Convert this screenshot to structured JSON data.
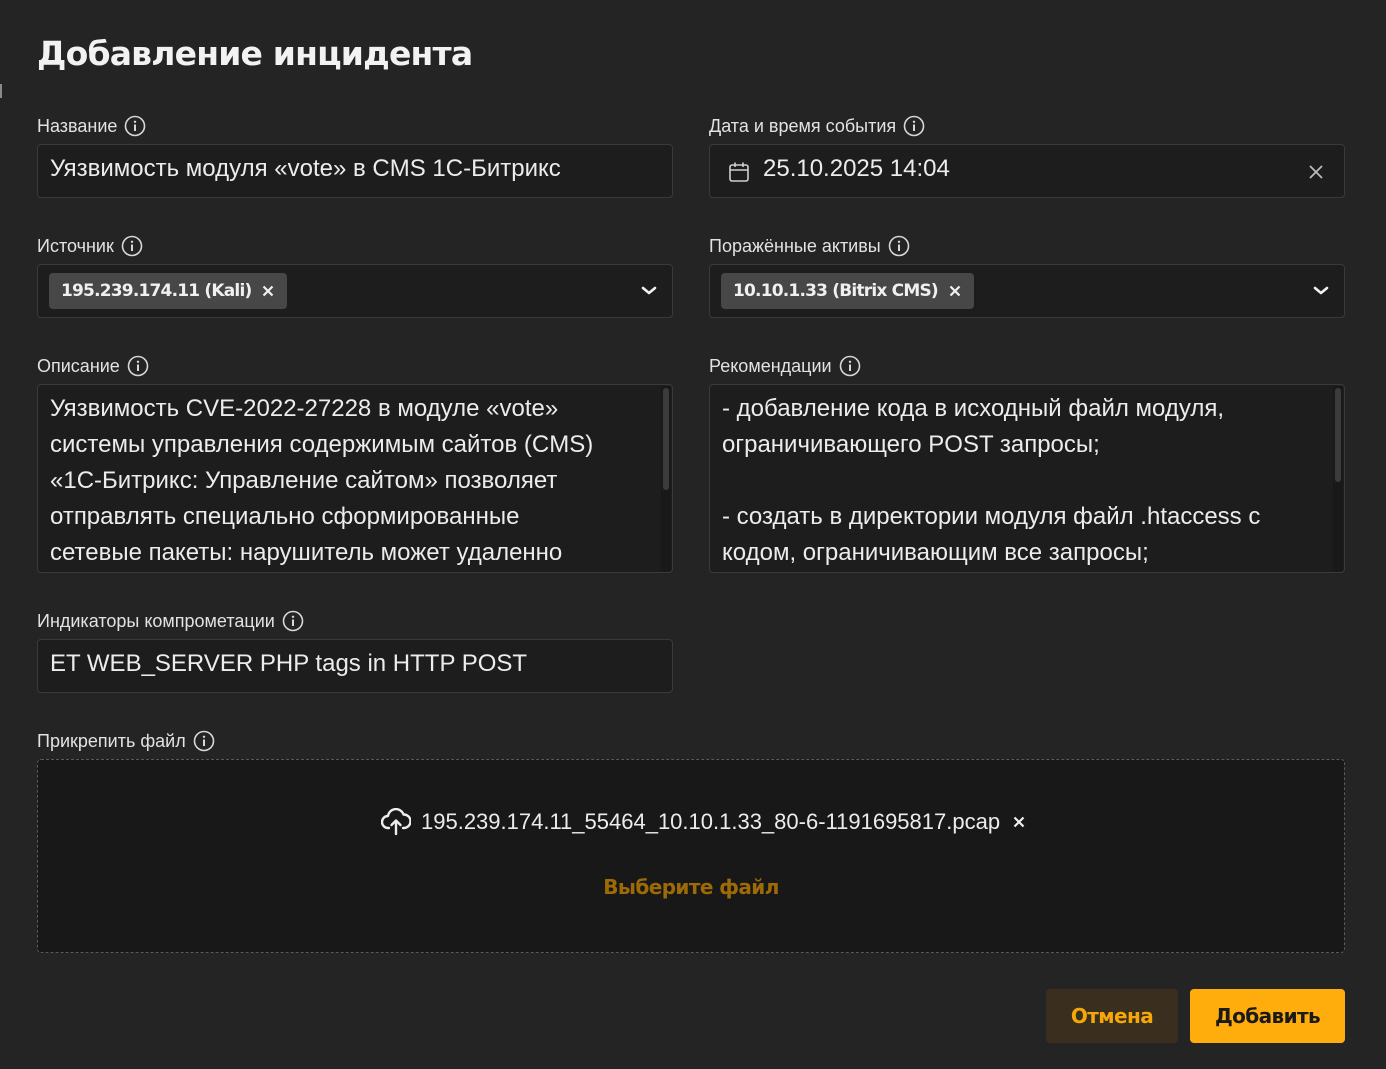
{
  "dialog": {
    "title": "Добавление инцидента"
  },
  "fields": {
    "name": {
      "label": "Название",
      "value": "Уязвимость модуля «vote» в CMS 1С-Битрикс"
    },
    "datetime": {
      "label": "Дата и время события",
      "value": "25.10.2025 14:04"
    },
    "source": {
      "label": "Источник",
      "tags": [
        "195.239.174.11 (Kali)"
      ]
    },
    "assets": {
      "label": "Поражённые активы",
      "tags": [
        "10.10.1.33 (Bitrix CMS)"
      ]
    },
    "description": {
      "label": "Описание",
      "value": "Уязвимость CVE-2022-27228 в модуле «vote»\nсистемы управления содержимым сайтов (CMS)\n«1С-Битрикс: Управление сайтом» позволяет\nотправлять специально сформированные\nсетевые пакеты: нарушитель может удаленно"
    },
    "recommendations": {
      "label": "Рекомендации",
      "value": "- добавление кода в исходный файл модуля,\nограничивающего POST запросы;\n\n- создать в директории модуля файл .htaccess с\nкодом, ограничивающим все запросы;"
    },
    "ioc": {
      "label": "Индикаторы компрометации",
      "value": "ET WEB_SERVER PHP tags in HTTP POST"
    },
    "attachment": {
      "label": "Прикрепить файл",
      "file_name": "195.239.174.11_55464_10.10.1.33_80-6-1191695817.pcap",
      "choose_label": "Выберите файл"
    }
  },
  "actions": {
    "cancel_label": "Отмена",
    "add_label": "Добавить"
  },
  "colors": {
    "background": "#242424",
    "accent": "#ffad0d",
    "accent_text": "#f5a70a",
    "muted_accent": "#9e6a05"
  },
  "icons": {
    "info": "info-circle-icon",
    "calendar": "calendar-icon",
    "clear": "close-icon",
    "chevron": "chevron-down-icon",
    "upload": "cloud-upload-icon"
  }
}
